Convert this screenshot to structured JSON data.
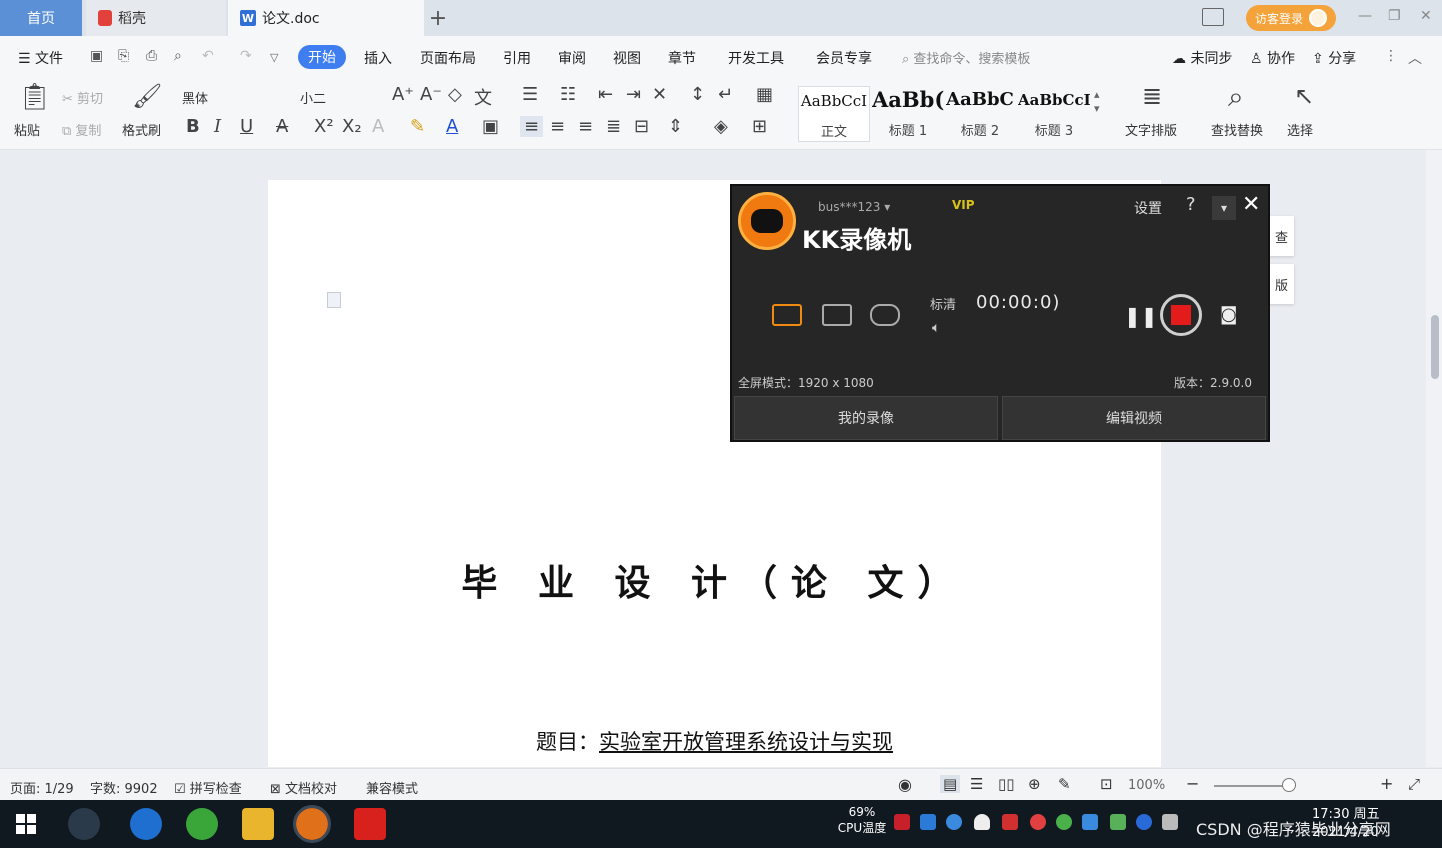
{
  "titlebar": {
    "tab_home": "首页",
    "tab_daoke": "稻壳",
    "tab_doc": "论文.doc",
    "tab_add": "+",
    "login_label": "访客登录"
  },
  "menu": {
    "file": "文件",
    "start": "开始",
    "insert": "插入",
    "layout": "页面布局",
    "reference": "引用",
    "review": "审阅",
    "view": "视图",
    "chapter": "章节",
    "devtools": "开发工具",
    "vip": "会员专享",
    "search_placeholder": "查找命令、搜索模板",
    "unsynced": "未同步",
    "collab": "协作",
    "share": "分享"
  },
  "ribbon": {
    "paste": "粘贴",
    "cut": "剪切",
    "copy": "复制",
    "format_painter": "格式刷",
    "font_name": "黑体",
    "font_size": "小二",
    "styles": [
      {
        "sample": "AaBbCcI",
        "name": "正文"
      },
      {
        "sample": "AaBb(",
        "name": "标题 1"
      },
      {
        "sample": "AaBbC",
        "name": "标题 2"
      },
      {
        "sample": "AaBbCcI",
        "name": "标题 3"
      }
    ],
    "text_layout": "文字排版",
    "find_replace": "查找替换",
    "select": "选择"
  },
  "document": {
    "title": "毕 业 设 计（论 文）",
    "subject_label": "题目：",
    "subject_value": "实验室开放管理系统设计与实现"
  },
  "side_tabs": [
    "查",
    "版"
  ],
  "recorder": {
    "app_name": "KK录像机",
    "user": "bus***123",
    "vip": "VIP",
    "settings": "设置",
    "help": "?",
    "close": "✕",
    "quality": "标清",
    "timer": "00:00:0)",
    "mode": "全屏模式：1920 x 1080",
    "version": "版本：2.9.0.0",
    "my_videos": "我的录像",
    "edit_video": "编辑视频"
  },
  "statusbar": {
    "page": "页面: 1/29",
    "words": "字数: 9902",
    "spellcheck": "拼写检查",
    "doc_proof": "文档校对",
    "compat": "兼容模式",
    "zoom": "100%"
  },
  "taskbar": {
    "cpu_percent": "69%",
    "cpu_label": "CPU温度",
    "time": "17:30 周五",
    "date": "2021/4/20",
    "watermark": "CSDN @程序猿毕业分享网"
  },
  "colors": {
    "accent": "#3f7ef0",
    "home_tab": "#5b8fd6",
    "login": "#f4a23a",
    "record": "#e31b1b"
  }
}
